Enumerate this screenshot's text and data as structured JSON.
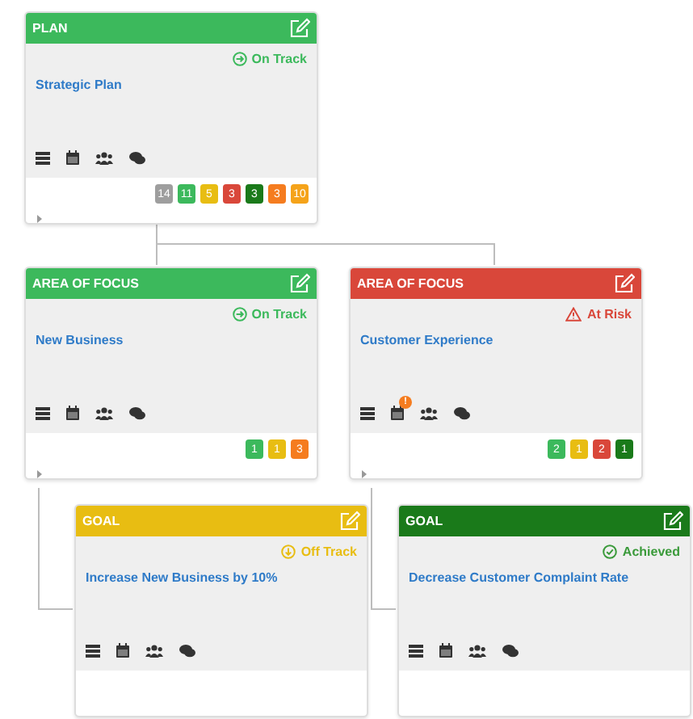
{
  "cards": [
    {
      "type": "PLAN",
      "status": {
        "kind": "on_track",
        "label": "On Track"
      },
      "title": "Strategic Plan",
      "counts": [
        {
          "value": "14",
          "color": "#9e9e9e"
        },
        {
          "value": "11",
          "color": "#3cb95c"
        },
        {
          "value": "5",
          "color": "#e8bd12"
        },
        {
          "value": "3",
          "color": "#d9473a"
        },
        {
          "value": "3",
          "color": "#1a7a1a"
        },
        {
          "value": "3",
          "color": "#f57c1f"
        },
        {
          "value": "10",
          "color": "#f5a31a"
        }
      ],
      "expanded": false
    },
    {
      "type": "AREA OF FOCUS",
      "status": {
        "kind": "on_track",
        "label": "On Track"
      },
      "title": "New Business",
      "counts": [
        {
          "value": "1",
          "color": "#3cb95c"
        },
        {
          "value": "1",
          "color": "#e8bd12"
        },
        {
          "value": "3",
          "color": "#f57c1f"
        }
      ],
      "expanded": false
    },
    {
      "type": "AREA OF FOCUS",
      "status": {
        "kind": "at_risk",
        "label": "At Risk"
      },
      "title": "Customer Experience",
      "calendar_alert": "!",
      "counts": [
        {
          "value": "2",
          "color": "#3cb95c"
        },
        {
          "value": "1",
          "color": "#e8bd12"
        },
        {
          "value": "2",
          "color": "#d9473a"
        },
        {
          "value": "1",
          "color": "#1a7a1a"
        }
      ],
      "expanded": false
    },
    {
      "type": "GOAL",
      "status": {
        "kind": "off_track",
        "label": "Off Track"
      },
      "title": "Increase New Business by 10%"
    },
    {
      "type": "GOAL",
      "status": {
        "kind": "achieved",
        "label": "Achieved"
      },
      "title": "Decrease Customer Complaint Rate"
    }
  ]
}
